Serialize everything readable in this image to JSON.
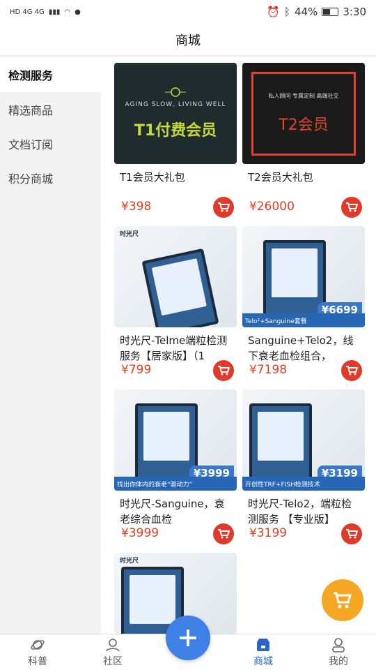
{
  "status": {
    "left_text": "HD 4G 4G",
    "battery": "44%",
    "time": "3:30"
  },
  "header": {
    "title": "商城"
  },
  "sidebar": {
    "items": [
      {
        "label": "检测服务",
        "active": true
      },
      {
        "label": "精选商品"
      },
      {
        "label": "文档订阅"
      },
      {
        "label": "积分商城"
      }
    ]
  },
  "products": [
    {
      "name": "T1会员大礼包",
      "price": "¥398",
      "thumb_title": "T1付费会员",
      "thumb_tag": "AGING SLOW, LIVING WELL"
    },
    {
      "name": "T2会员大礼包",
      "price": "¥26000",
      "thumb_title": "T2会员",
      "thumb_tag": "私人顾问  专属定制  高端社交"
    },
    {
      "name": "时光尺-Telme端粒检测服务【居家版】（1",
      "price": "¥799",
      "thumb_brand": "时光尺"
    },
    {
      "name": "Sanguine+Telo2，线下衰老血检组合，",
      "price": "¥7198",
      "thumb_band": "Telo²+Sanguine套餐",
      "thumb_price": "¥6699"
    },
    {
      "name": "时光尺-Sanguine，衰老综合血检",
      "price": "¥3999",
      "thumb_band": "找出你体内的衰老“驱动力”",
      "thumb_price": "¥3999"
    },
    {
      "name": "时光尺-Telo2，端粒检测服务 【专业版】",
      "price": "¥3199",
      "thumb_band": "开创性TRF+FISH检测技术",
      "thumb_price": "¥3199"
    },
    {
      "name": "",
      "price": "",
      "thumb_brand": "时光尺"
    }
  ],
  "tabbar": {
    "items": [
      {
        "label": "科普"
      },
      {
        "label": "社区"
      },
      {
        "label": ""
      },
      {
        "label": "商城",
        "active": true
      },
      {
        "label": "我的"
      }
    ]
  },
  "colors": {
    "accent": "#2a64c8",
    "price": "#e0401f",
    "cart": "#e03a2a",
    "fab": "#3f80e6",
    "cart_fab": "#f5a623"
  }
}
